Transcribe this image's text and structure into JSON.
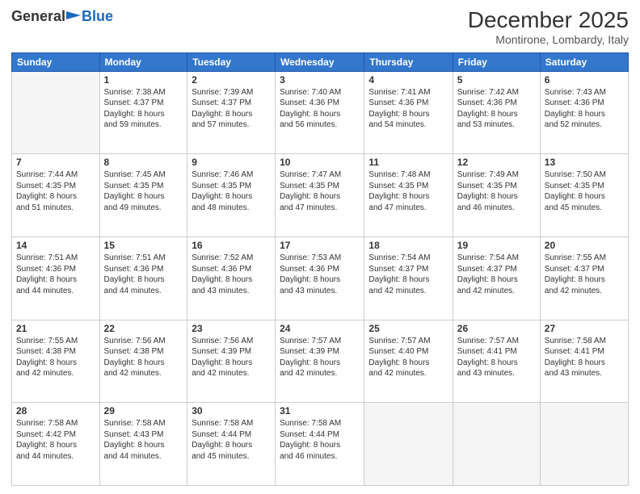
{
  "header": {
    "logo_general": "General",
    "logo_blue": "Blue",
    "month_title": "December 2025",
    "location": "Montirone, Lombardy, Italy"
  },
  "weekdays": [
    "Sunday",
    "Monday",
    "Tuesday",
    "Wednesday",
    "Thursday",
    "Friday",
    "Saturday"
  ],
  "weeks": [
    [
      {
        "day": "",
        "info": ""
      },
      {
        "day": "1",
        "info": "Sunrise: 7:38 AM\nSunset: 4:37 PM\nDaylight: 8 hours\nand 59 minutes."
      },
      {
        "day": "2",
        "info": "Sunrise: 7:39 AM\nSunset: 4:37 PM\nDaylight: 8 hours\nand 57 minutes."
      },
      {
        "day": "3",
        "info": "Sunrise: 7:40 AM\nSunset: 4:36 PM\nDaylight: 8 hours\nand 56 minutes."
      },
      {
        "day": "4",
        "info": "Sunrise: 7:41 AM\nSunset: 4:36 PM\nDaylight: 8 hours\nand 54 minutes."
      },
      {
        "day": "5",
        "info": "Sunrise: 7:42 AM\nSunset: 4:36 PM\nDaylight: 8 hours\nand 53 minutes."
      },
      {
        "day": "6",
        "info": "Sunrise: 7:43 AM\nSunset: 4:36 PM\nDaylight: 8 hours\nand 52 minutes."
      }
    ],
    [
      {
        "day": "7",
        "info": "Sunrise: 7:44 AM\nSunset: 4:35 PM\nDaylight: 8 hours\nand 51 minutes."
      },
      {
        "day": "8",
        "info": "Sunrise: 7:45 AM\nSunset: 4:35 PM\nDaylight: 8 hours\nand 49 minutes."
      },
      {
        "day": "9",
        "info": "Sunrise: 7:46 AM\nSunset: 4:35 PM\nDaylight: 8 hours\nand 48 minutes."
      },
      {
        "day": "10",
        "info": "Sunrise: 7:47 AM\nSunset: 4:35 PM\nDaylight: 8 hours\nand 47 minutes."
      },
      {
        "day": "11",
        "info": "Sunrise: 7:48 AM\nSunset: 4:35 PM\nDaylight: 8 hours\nand 47 minutes."
      },
      {
        "day": "12",
        "info": "Sunrise: 7:49 AM\nSunset: 4:35 PM\nDaylight: 8 hours\nand 46 minutes."
      },
      {
        "day": "13",
        "info": "Sunrise: 7:50 AM\nSunset: 4:35 PM\nDaylight: 8 hours\nand 45 minutes."
      }
    ],
    [
      {
        "day": "14",
        "info": "Sunrise: 7:51 AM\nSunset: 4:36 PM\nDaylight: 8 hours\nand 44 minutes."
      },
      {
        "day": "15",
        "info": "Sunrise: 7:51 AM\nSunset: 4:36 PM\nDaylight: 8 hours\nand 44 minutes."
      },
      {
        "day": "16",
        "info": "Sunrise: 7:52 AM\nSunset: 4:36 PM\nDaylight: 8 hours\nand 43 minutes."
      },
      {
        "day": "17",
        "info": "Sunrise: 7:53 AM\nSunset: 4:36 PM\nDaylight: 8 hours\nand 43 minutes."
      },
      {
        "day": "18",
        "info": "Sunrise: 7:54 AM\nSunset: 4:37 PM\nDaylight: 8 hours\nand 42 minutes."
      },
      {
        "day": "19",
        "info": "Sunrise: 7:54 AM\nSunset: 4:37 PM\nDaylight: 8 hours\nand 42 minutes."
      },
      {
        "day": "20",
        "info": "Sunrise: 7:55 AM\nSunset: 4:37 PM\nDaylight: 8 hours\nand 42 minutes."
      }
    ],
    [
      {
        "day": "21",
        "info": "Sunrise: 7:55 AM\nSunset: 4:38 PM\nDaylight: 8 hours\nand 42 minutes."
      },
      {
        "day": "22",
        "info": "Sunrise: 7:56 AM\nSunset: 4:38 PM\nDaylight: 8 hours\nand 42 minutes."
      },
      {
        "day": "23",
        "info": "Sunrise: 7:56 AM\nSunset: 4:39 PM\nDaylight: 8 hours\nand 42 minutes."
      },
      {
        "day": "24",
        "info": "Sunrise: 7:57 AM\nSunset: 4:39 PM\nDaylight: 8 hours\nand 42 minutes."
      },
      {
        "day": "25",
        "info": "Sunrise: 7:57 AM\nSunset: 4:40 PM\nDaylight: 8 hours\nand 42 minutes."
      },
      {
        "day": "26",
        "info": "Sunrise: 7:57 AM\nSunset: 4:41 PM\nDaylight: 8 hours\nand 43 minutes."
      },
      {
        "day": "27",
        "info": "Sunrise: 7:58 AM\nSunset: 4:41 PM\nDaylight: 8 hours\nand 43 minutes."
      }
    ],
    [
      {
        "day": "28",
        "info": "Sunrise: 7:58 AM\nSunset: 4:42 PM\nDaylight: 8 hours\nand 44 minutes."
      },
      {
        "day": "29",
        "info": "Sunrise: 7:58 AM\nSunset: 4:43 PM\nDaylight: 8 hours\nand 44 minutes."
      },
      {
        "day": "30",
        "info": "Sunrise: 7:58 AM\nSunset: 4:44 PM\nDaylight: 8 hours\nand 45 minutes."
      },
      {
        "day": "31",
        "info": "Sunrise: 7:58 AM\nSunset: 4:44 PM\nDaylight: 8 hours\nand 46 minutes."
      },
      {
        "day": "",
        "info": ""
      },
      {
        "day": "",
        "info": ""
      },
      {
        "day": "",
        "info": ""
      }
    ]
  ]
}
